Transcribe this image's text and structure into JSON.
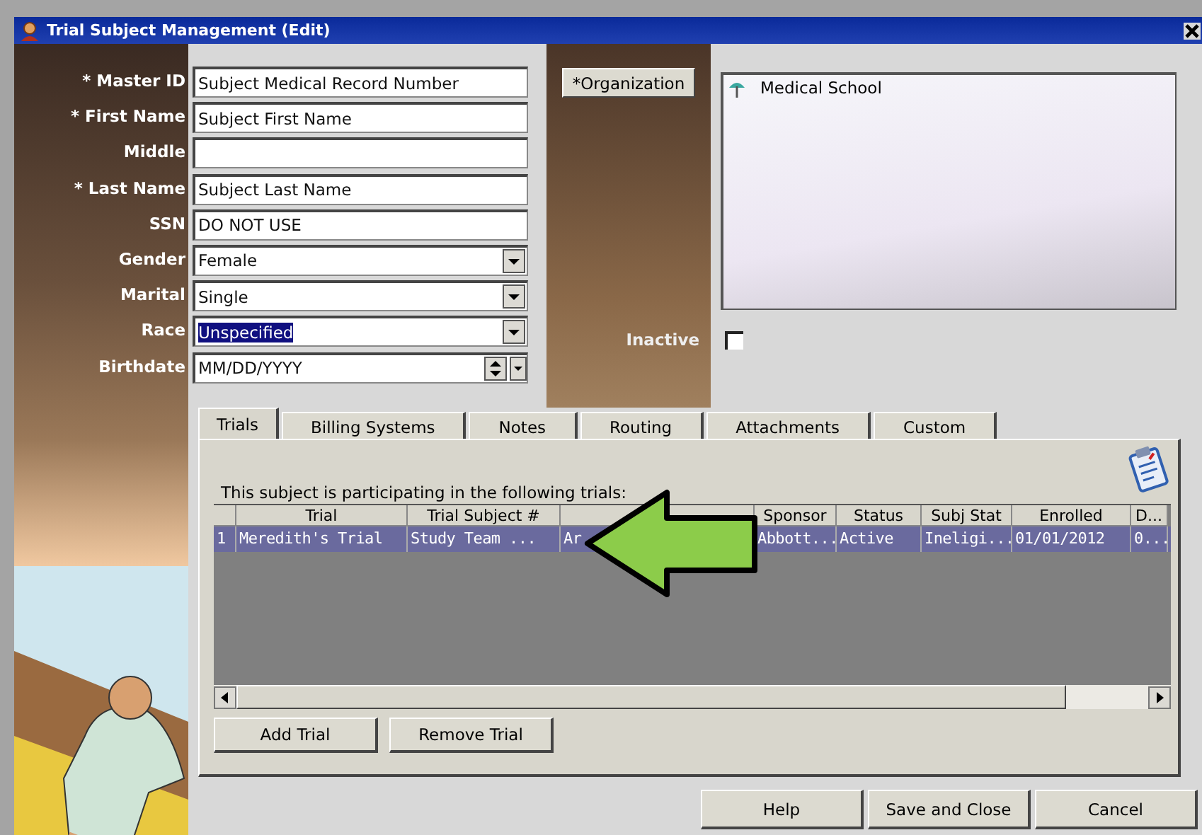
{
  "window": {
    "title": "Trial Subject Management (Edit)"
  },
  "fields": [
    {
      "label": "* Master ID",
      "kind": "text",
      "value": "Subject Medical Record Number",
      "highlighted": false
    },
    {
      "label": "* First Name",
      "kind": "text",
      "value": "Subject First Name",
      "highlighted": false
    },
    {
      "label": "Middle",
      "kind": "text",
      "highlighted": false
    },
    {
      "label": "* Last Name",
      "kind": "text",
      "value": "Subject Last Name",
      "highlighted": false
    },
    {
      "label": "SSN",
      "kind": "text",
      "value": "DO NOT USE",
      "highlighted": false
    },
    {
      "label": "Gender",
      "kind": "select",
      "value": "Female",
      "highlighted": false
    },
    {
      "label": "Marital",
      "kind": "select",
      "value": "Single",
      "highlighted": false
    },
    {
      "label": "Race",
      "kind": "select",
      "value": "Unspecified",
      "highlighted": true
    },
    {
      "label": "Birthdate",
      "kind": "date",
      "value": "MM/DD/YYYY",
      "highlighted": false
    }
  ],
  "organization": {
    "button": "*Organization",
    "items": [
      "Medical School"
    ]
  },
  "inactive": {
    "label": "Inactive",
    "checked": false
  },
  "tabs": [
    {
      "label": "Trials",
      "selected": true
    },
    {
      "label": "Billing Systems",
      "selected": false
    },
    {
      "label": "Notes",
      "selected": false
    },
    {
      "label": "Routing",
      "selected": false
    },
    {
      "label": "Attachments",
      "selected": false
    },
    {
      "label": "Custom",
      "selected": false
    }
  ],
  "trials": {
    "caption": "This subject is participating in the following trials:",
    "columns": [
      {
        "label": "Trial"
      },
      {
        "label": "Trial Subject #"
      },
      {},
      {
        "label": "Sponsor"
      },
      {
        "label": "Status"
      },
      {
        "label": "Subj Stat"
      },
      {
        "label": "Enrolled"
      },
      {
        "label": "D..."
      }
    ],
    "rows": [
      {
        "number": "1",
        "selected": true,
        "cells": [
          "Meredith's Trial",
          "Study Team ...",
          "Ar",
          "Abbott...",
          "Active",
          "Ineligi...",
          "01/01/2012",
          "0..."
        ]
      }
    ],
    "buttons": [
      "Add Trial",
      "Remove Trial"
    ]
  },
  "footer_buttons": [
    "Help",
    "Save and Close",
    "Cancel"
  ]
}
